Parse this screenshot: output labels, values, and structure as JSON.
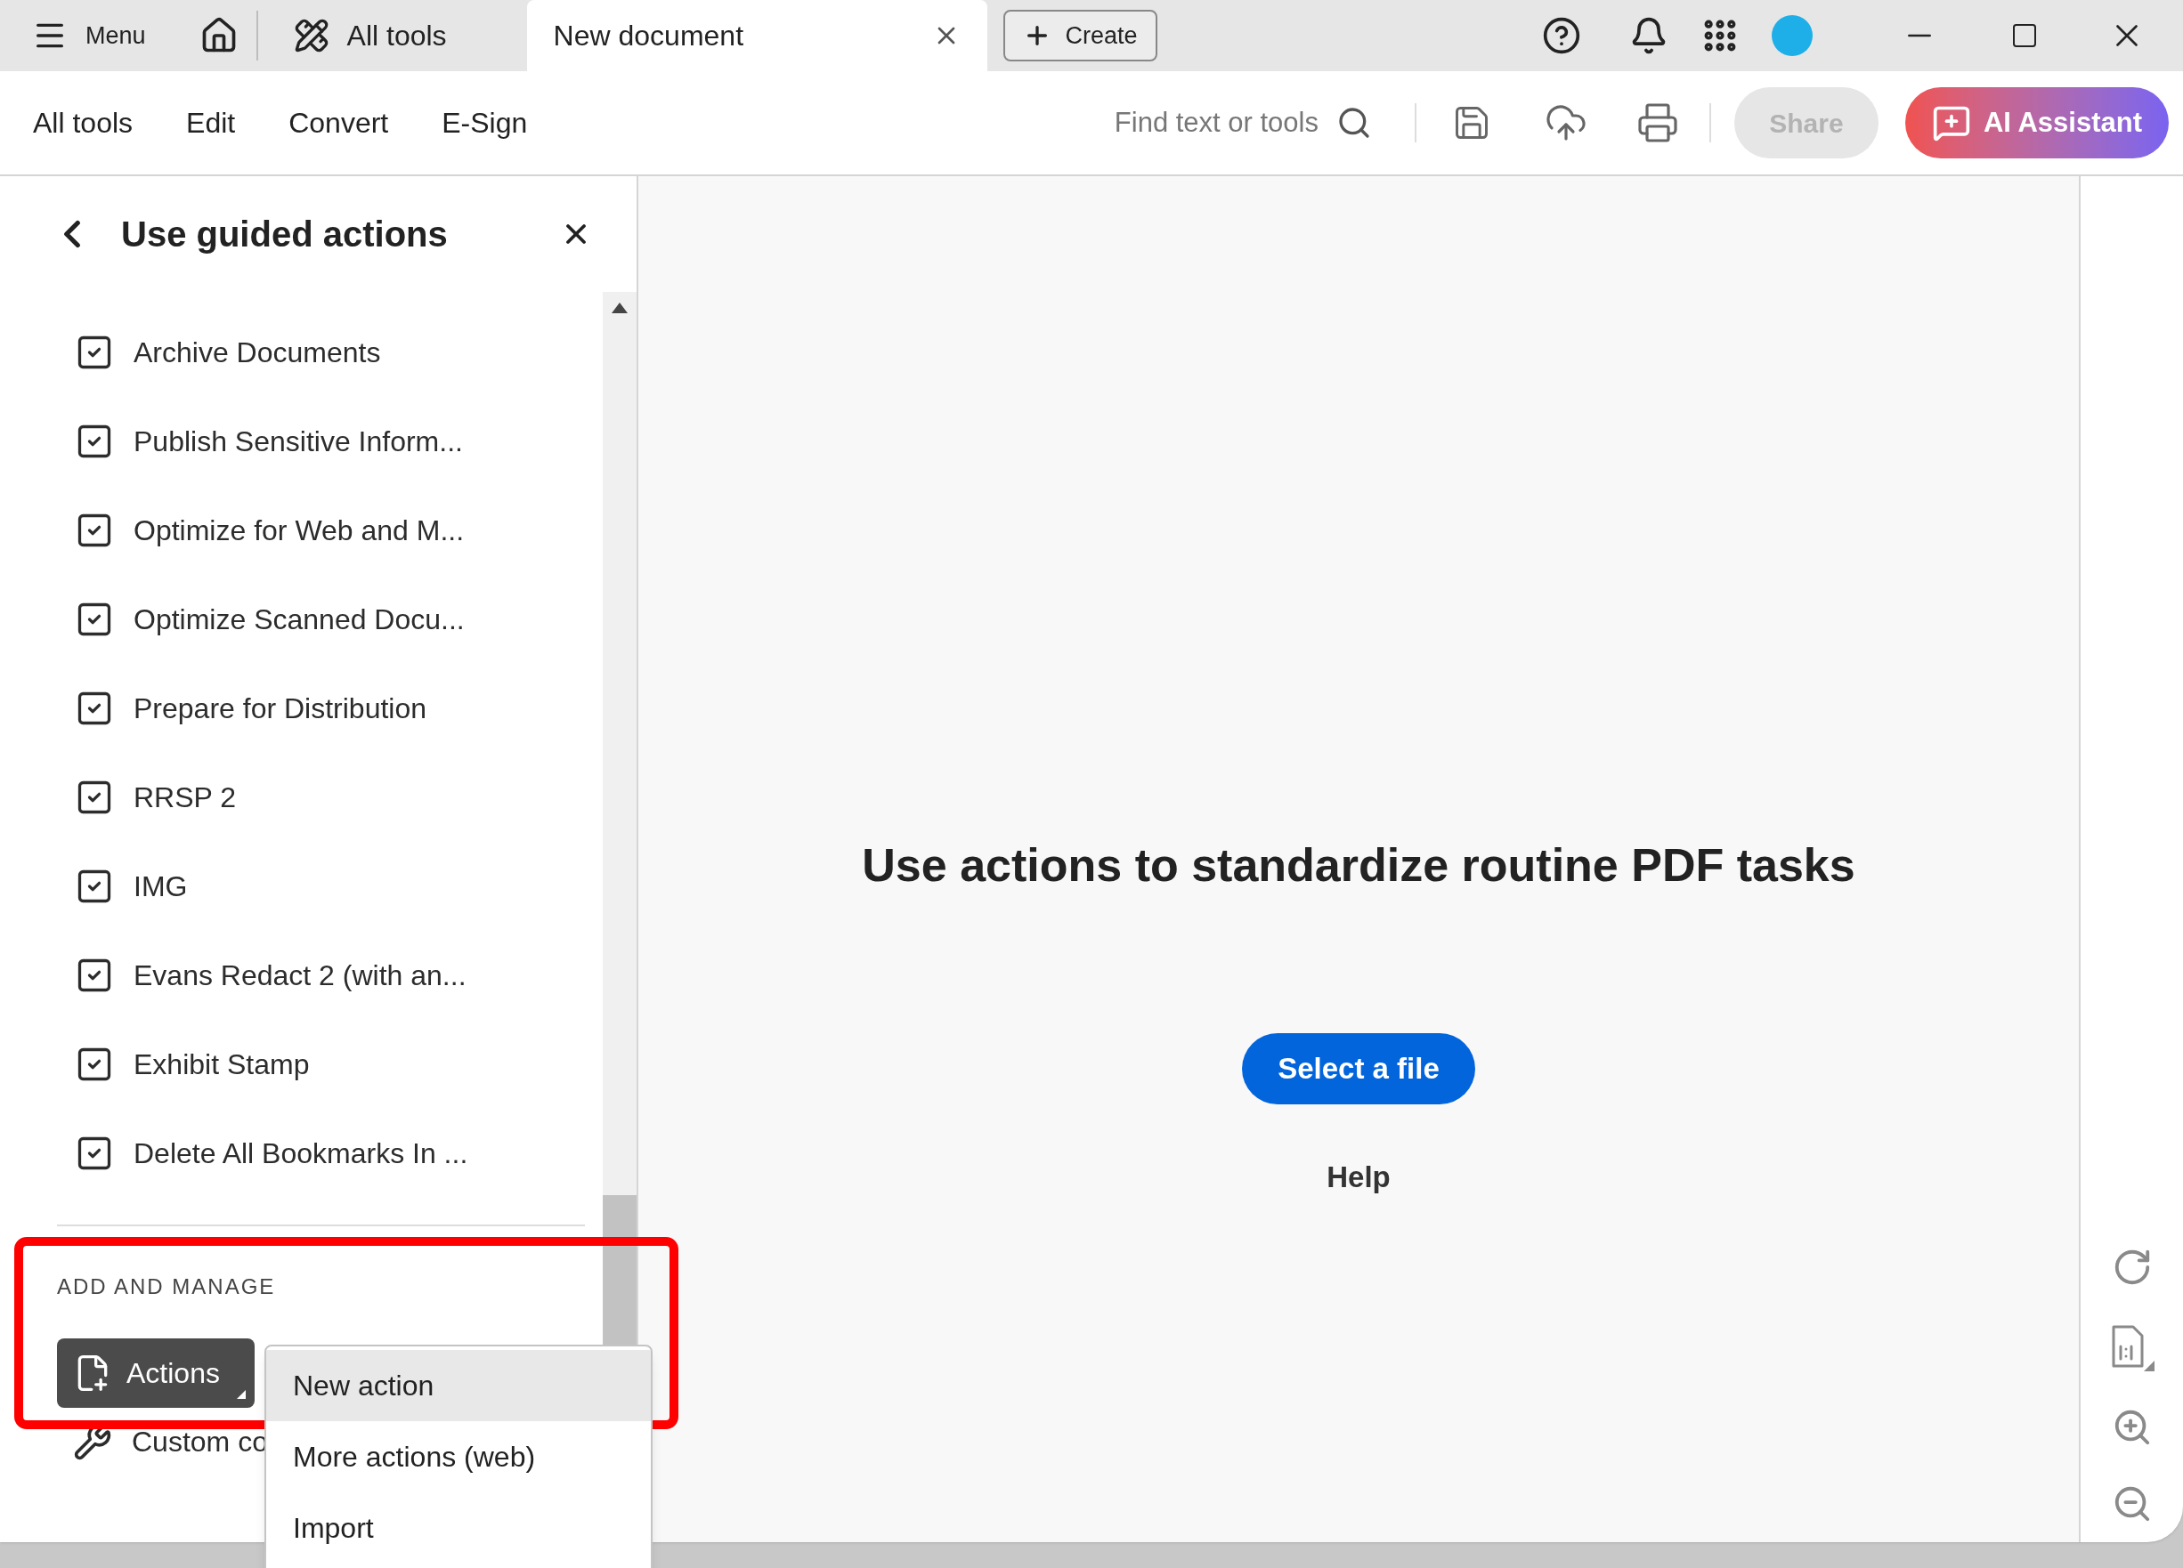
{
  "title_bar": {
    "menu_label": "Menu",
    "tabs": [
      {
        "label": "All tools",
        "selected": false
      },
      {
        "label": "New document",
        "selected": true
      }
    ],
    "create_label": "Create"
  },
  "toolbar": {
    "items": [
      "All tools",
      "Edit",
      "Convert",
      "E-Sign"
    ],
    "search": {
      "placeholder": "Find text or tools"
    },
    "share": {
      "label": "Share",
      "disabled": true
    },
    "ai_label": "AI Assistant"
  },
  "panel": {
    "title": "Use guided actions",
    "actions": [
      "Archive Documents",
      "Publish Sensitive Inform...",
      "Optimize for Web and M...",
      "Optimize Scanned Docu...",
      "Prepare for Distribution",
      "RRSP 2",
      "IMG",
      "Evans Redact 2 (with an...",
      "Exhibit Stamp",
      "Delete All Bookmarks In ..."
    ],
    "section_heading": "ADD AND MANAGE",
    "actions_button": "Actions",
    "custom_label": "Custom co",
    "menu": [
      {
        "label": "New action",
        "selected": true
      },
      {
        "label": "More actions (web)",
        "selected": false
      },
      {
        "label": "Import",
        "selected": false
      }
    ]
  },
  "main": {
    "headline": "Use actions to standardize routine PDF tasks",
    "button": "Select a file",
    "help": "Help"
  }
}
